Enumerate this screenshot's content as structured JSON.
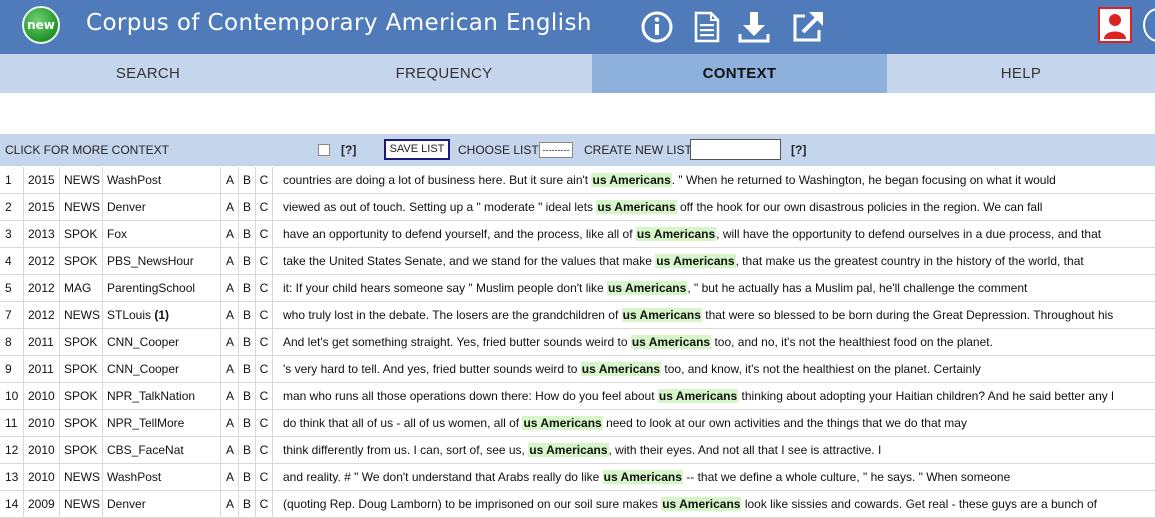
{
  "header": {
    "badge": "new",
    "title": "Corpus of Contemporary American English",
    "icons": [
      "info-icon",
      "document-icon",
      "download-icon",
      "external-link-icon",
      "user-icon"
    ],
    "colors": {
      "bar": "#4f7bba",
      "tabs": "#c5d6ec",
      "active_tab": "#8eb1dc",
      "highlight": "#d6f5c8"
    }
  },
  "tabs": [
    {
      "label": "SEARCH",
      "active": false
    },
    {
      "label": "FREQUENCY",
      "active": false
    },
    {
      "label": "CONTEXT",
      "active": true
    },
    {
      "label": "HELP",
      "active": false
    }
  ],
  "controls": {
    "context_label": "CLICK FOR MORE CONTEXT",
    "help1": "[?]",
    "save_list": "SAVE LIST",
    "choose_list_label": "CHOOSE LIST",
    "choose_list_value": "---------",
    "create_new_list_label": "CREATE NEW LIST",
    "create_new_list_value": "",
    "help2": "[?]"
  },
  "rows": [
    {
      "num": "1",
      "year": "2015",
      "genre": "NEWS",
      "source": "WashPost",
      "count": "",
      "a": "A",
      "b": "B",
      "c": "C",
      "before": "countries are doing a lot of business here. But it sure ain't",
      "kw": "us Americans",
      "after": ". \" When he returned to Washington, he began focusing on what it would"
    },
    {
      "num": "2",
      "year": "2015",
      "genre": "NEWS",
      "source": "Denver",
      "count": "",
      "a": "A",
      "b": "B",
      "c": "C",
      "before": "viewed as out of touch. Setting up a \" moderate \" ideal lets",
      "kw": "us Americans",
      "after": "off the hook for our own disastrous policies in the region. We can fall"
    },
    {
      "num": "3",
      "year": "2013",
      "genre": "SPOK",
      "source": "Fox",
      "count": "",
      "a": "A",
      "b": "B",
      "c": "C",
      "before": "have an opportunity to defend yourself, and the process, like all of",
      "kw": "us Americans",
      "after": ", will have the opportunity to defend ourselves in a due process, and that"
    },
    {
      "num": "4",
      "year": "2012",
      "genre": "SPOK",
      "source": "PBS_NewsHour",
      "count": "",
      "a": "A",
      "b": "B",
      "c": "C",
      "before": "take the United States Senate, and we stand for the values that make",
      "kw": "us Americans",
      "after": ", that make us the greatest country in the history of the world, that"
    },
    {
      "num": "5",
      "year": "2012",
      "genre": "MAG",
      "source": "ParentingSchool",
      "count": "",
      "a": "A",
      "b": "B",
      "c": "C",
      "before": "it: If your child hears someone say \" Muslim people don't like",
      "kw": "us Americans",
      "after": ", \" but he actually has a Muslim pal, he'll challenge the comment"
    },
    {
      "num": "7",
      "year": "2012",
      "genre": "NEWS",
      "source": "STLouis",
      "count": "(1)",
      "a": "A",
      "b": "B",
      "c": "C",
      "before": "who truly lost in the debate. The losers are the grandchildren of",
      "kw": "us Americans",
      "after": "that were so blessed to be born during the Great Depression. Throughout his"
    },
    {
      "num": "8",
      "year": "2011",
      "genre": "SPOK",
      "source": "CNN_Cooper",
      "count": "",
      "a": "A",
      "b": "B",
      "c": "C",
      "before": "And let's get something straight. Yes, fried butter sounds weird to",
      "kw": "us Americans",
      "after": "too, and no, it's not the healthiest food on the planet."
    },
    {
      "num": "9",
      "year": "2011",
      "genre": "SPOK",
      "source": "CNN_Cooper",
      "count": "",
      "a": "A",
      "b": "B",
      "c": "C",
      "before": "'s very hard to tell. And yes, fried butter sounds weird to",
      "kw": "us Americans",
      "after": "too, and know, it's not the healthiest on the planet. Certainly"
    },
    {
      "num": "10",
      "year": "2010",
      "genre": "SPOK",
      "source": "NPR_TalkNation",
      "count": "",
      "a": "A",
      "b": "B",
      "c": "C",
      "before": "man who runs all those operations down there: How do you feel about",
      "kw": "us Americans",
      "after": "thinking about adopting your Haitian children? And he said better any l"
    },
    {
      "num": "11",
      "year": "2010",
      "genre": "SPOK",
      "source": "NPR_TellMore",
      "count": "",
      "a": "A",
      "b": "B",
      "c": "C",
      "before": "do think that all of us - all of us women, all of",
      "kw": "us Americans",
      "after": "need to look at our own activities and the things that we do that may"
    },
    {
      "num": "12",
      "year": "2010",
      "genre": "SPOK",
      "source": "CBS_FaceNat",
      "count": "",
      "a": "A",
      "b": "B",
      "c": "C",
      "before": "think differently from us. I can, sort of, see us,",
      "kw": "us Americans",
      "after": ", with their eyes. And not all that I see is attractive. I"
    },
    {
      "num": "13",
      "year": "2010",
      "genre": "NEWS",
      "source": "WashPost",
      "count": "",
      "a": "A",
      "b": "B",
      "c": "C",
      "before": "and reality. # \" We don't understand that Arabs really do like",
      "kw": "us Americans",
      "after": "-- that we define a whole culture, \" he says. \" When someone"
    },
    {
      "num": "14",
      "year": "2009",
      "genre": "NEWS",
      "source": "Denver",
      "count": "",
      "a": "A",
      "b": "B",
      "c": "C",
      "before": "(quoting Rep. Doug Lamborn) to be imprisoned on our soil sure makes",
      "kw": "us Americans",
      "after": "look like sissies and cowards. Get real - these guys are a bunch of"
    }
  ]
}
